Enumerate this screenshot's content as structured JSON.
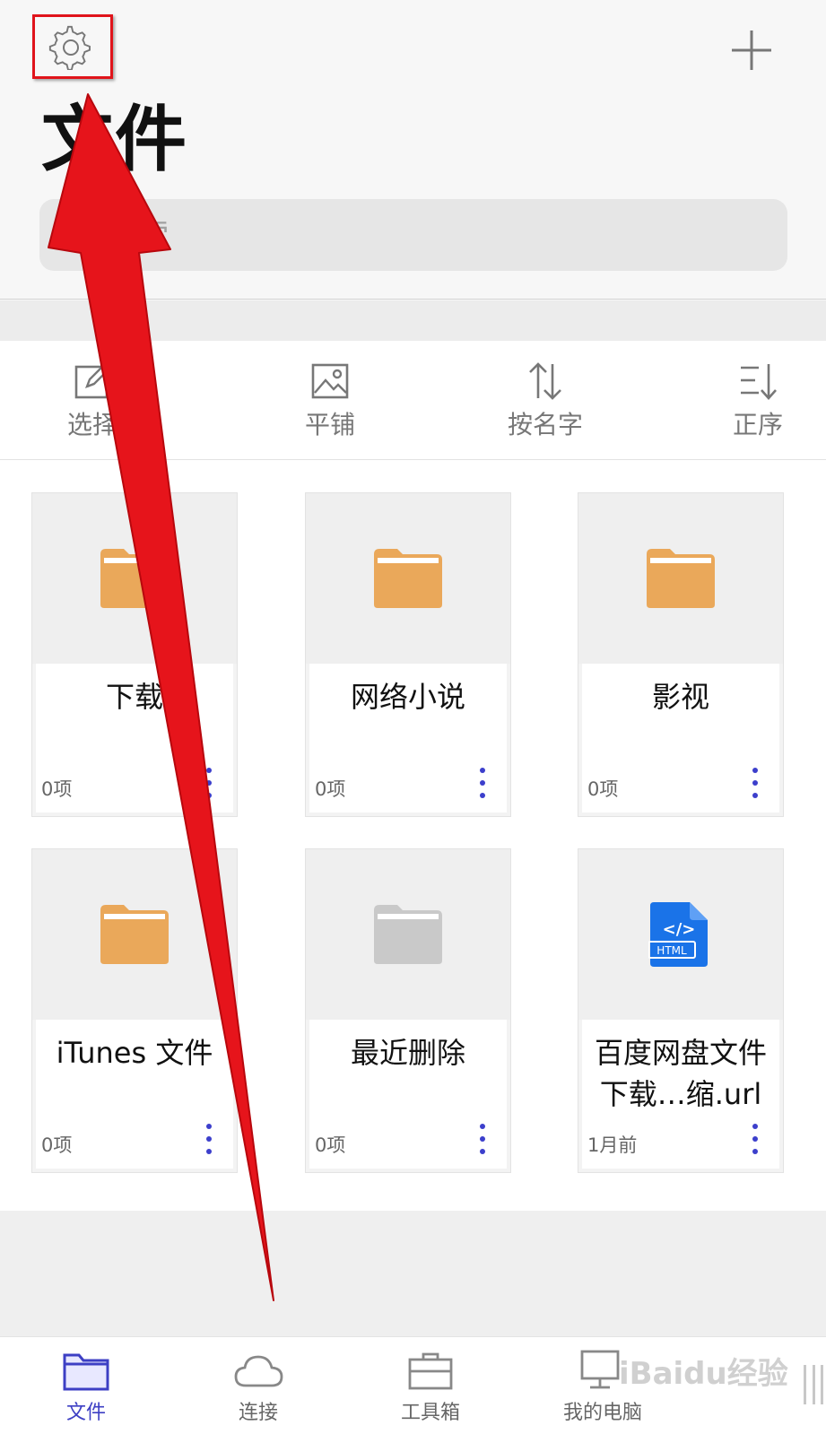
{
  "header": {
    "title": "文件",
    "search_placeholder": "搜索"
  },
  "toolbar": {
    "items": [
      {
        "label": "选择",
        "icon": "edit-select-icon"
      },
      {
        "label": "平铺",
        "icon": "image-grid-icon"
      },
      {
        "label": "按名字",
        "icon": "sort-arrows-icon"
      },
      {
        "label": "正序",
        "icon": "ascending-order-icon"
      }
    ]
  },
  "files": [
    {
      "name": "下载",
      "meta": "0项",
      "type": "folder"
    },
    {
      "name": "网络小说",
      "meta": "0项",
      "type": "folder"
    },
    {
      "name": "影视",
      "meta": "0项",
      "type": "folder"
    },
    {
      "name": "iTunes 文件",
      "meta": "0项",
      "type": "folder"
    },
    {
      "name": "最近删除",
      "meta": "0项",
      "type": "folder-gray"
    },
    {
      "name": "百度网盘文件下载…缩.url",
      "meta": "1月前",
      "type": "html-file",
      "badge": "HTML",
      "code_glyph": "</>"
    }
  ],
  "tabbar": {
    "items": [
      {
        "label": "文件",
        "active": true
      },
      {
        "label": "连接",
        "active": false
      },
      {
        "label": "工具箱",
        "active": false
      },
      {
        "label": "我的电脑",
        "active": false
      }
    ]
  },
  "colors": {
    "accent": "#3d3fc4",
    "folder": "#eaa85a",
    "folder_gray": "#c9c9c9",
    "html_blue": "#1a73e8",
    "annotation_red": "#e0141b"
  },
  "watermark": "iBaidu经验"
}
